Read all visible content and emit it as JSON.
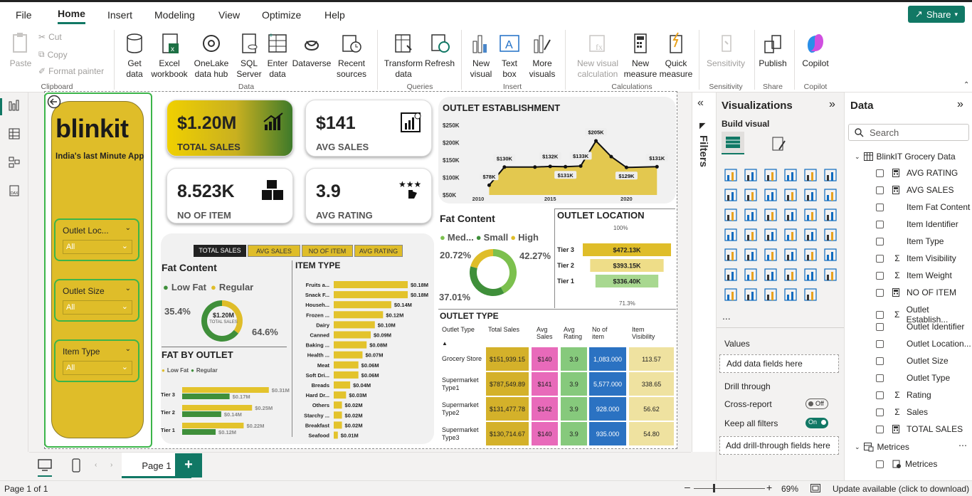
{
  "menu": [
    "File",
    "Home",
    "Insert",
    "Modeling",
    "View",
    "Optimize",
    "Help"
  ],
  "share_label": "Share",
  "ribbon": {
    "clipboard": {
      "paste": "Paste",
      "cut": "Cut",
      "copy": "Copy",
      "format_painter": "Format painter",
      "group": "Clipboard"
    },
    "data": {
      "get_data": "Get",
      "get_data2": "data",
      "excel": "Excel",
      "excel2": "workbook",
      "onelake": "OneLake",
      "onelake2": "data hub",
      "sql": "SQL",
      "sql2": "Server",
      "enter": "Enter",
      "enter2": "data",
      "dataverse": "Dataverse",
      "recent": "Recent",
      "recent2": "sources",
      "group": "Data"
    },
    "queries": {
      "transform": "Transform",
      "transform2": "data",
      "refresh": "Refresh",
      "group": "Queries"
    },
    "insert": {
      "new_visual": "New",
      "new_visual2": "visual",
      "text_box": "Text",
      "text_box2": "box",
      "more_visuals": "More",
      "more_visuals2": "visuals",
      "group": "Insert"
    },
    "calculations": {
      "new_visual_calc": "New visual",
      "new_visual_calc2": "calculation",
      "new_measure": "New",
      "new_measure2": "measure",
      "quick_measure": "Quick",
      "quick_measure2": "measure",
      "group": "Calculations"
    },
    "sensitivity": {
      "label": "Sensitivity",
      "group": "Sensitivity"
    },
    "share": {
      "publish": "Publish",
      "group": "Share"
    },
    "copilot": {
      "label": "Copilot",
      "group": "Copilot"
    }
  },
  "report": {
    "logo": "blinkit",
    "tagline": "India's last Minute App",
    "slicers": [
      {
        "title": "Outlet Loc...",
        "value": "All"
      },
      {
        "title": "Outlet Size",
        "value": "All"
      },
      {
        "title": "Item Type",
        "value": "All"
      }
    ],
    "kpis": [
      {
        "value": "$1.20M",
        "label": "TOTAL SALES"
      },
      {
        "value": "$141",
        "label": "AVG SALES"
      },
      {
        "value": "8.523K",
        "label": "NO OF ITEM"
      },
      {
        "value": "3.9",
        "label": "AVG RATING"
      }
    ],
    "tabs": [
      "TOTAL SALES",
      "AVG SALES",
      "NO OF ITEM",
      "AVG RATING"
    ],
    "fat_content": {
      "title": "Fat Content",
      "legend": [
        "Low Fat",
        "Regular"
      ],
      "pct_left": "35.4%",
      "pct_right": "64.6%",
      "center_value": "$1.20M",
      "center_label": "TOTAL SALES"
    },
    "fat_by_outlet": {
      "title": "FAT BY OUTLET",
      "legend": [
        "Low Fat",
        "Regular"
      ]
    },
    "item_type": {
      "title": "ITEM TYPE"
    },
    "establishment": {
      "title": "OUTLET ESTABLISHMENT"
    },
    "fat_content2": {
      "title": "Fat Content",
      "legend": [
        "Med...",
        "Small",
        "High"
      ],
      "pct_a": "20.72%",
      "pct_b": "42.27%",
      "pct_c": "37.01%"
    },
    "outlet_location": {
      "title": "OUTLET LOCATION",
      "top_pct": "100%",
      "bottom_pct": "71.3%"
    },
    "outlet_type": {
      "title": "OUTLET TYPE",
      "headers": [
        "Outlet Type",
        "Total Sales",
        "Avg Sales",
        "Avg Rating",
        "No of item",
        "Item Visibility"
      ],
      "rows": [
        [
          "Grocery Store",
          "$151,939.15",
          "$140",
          "3.9",
          "1,083.000",
          "113.57"
        ],
        [
          "Supermarket Type1",
          "$787,549.89",
          "$141",
          "3.9",
          "5,577.000",
          "338.65"
        ],
        [
          "Supermarket Type2",
          "$131,477.78",
          "$142",
          "3.9",
          "928.000",
          "56.62"
        ],
        [
          "Supermarket Type3",
          "$130,714.67",
          "$140",
          "3.9",
          "935.000",
          "54.80"
        ]
      ]
    }
  },
  "chart_data": [
    {
      "type": "line",
      "title": "OUTLET ESTABLISHMENT",
      "x": [
        2011,
        2012,
        2014,
        2015,
        2016,
        2017,
        2018,
        2019,
        2020,
        2022
      ],
      "values": [
        78,
        130,
        130,
        132,
        131,
        133,
        205,
        160,
        129,
        131
      ],
      "data_labels": [
        "$78K",
        "$130K",
        "",
        "$132K",
        "$131K",
        "$133K",
        "$205K",
        "",
        "$129K",
        "$131K"
      ],
      "y_ticks": [
        "$250K",
        "$200K",
        "$150K",
        "$100K",
        "$50K"
      ],
      "x_ticks": [
        "2010",
        "2015",
        "2020"
      ],
      "ylim": [
        50,
        250
      ],
      "color": "#e3c84f"
    },
    {
      "type": "bar",
      "title": "ITEM TYPE",
      "categories": [
        "Fruits a...",
        "Snack F...",
        "Househ...",
        "Frozen ...",
        "Dairy",
        "Canned",
        "Baking ...",
        "Health ...",
        "Meat",
        "Soft Dri...",
        "Breads",
        "Hard Dr...",
        "Others",
        "Starchy ...",
        "Breakfast",
        "Seafood"
      ],
      "values": [
        0.18,
        0.18,
        0.14,
        0.12,
        0.1,
        0.09,
        0.08,
        0.07,
        0.06,
        0.06,
        0.04,
        0.03,
        0.02,
        0.02,
        0.02,
        0.01
      ],
      "labels": [
        "$0.18M",
        "$0.18M",
        "$0.14M",
        "$0.12M",
        "$0.10M",
        "$0.09M",
        "$0.08M",
        "$0.07M",
        "$0.06M",
        "$0.06M",
        "$0.04M",
        "$0.03M",
        "$0.02M",
        "$0.02M",
        "$0.02M",
        "$0.01M"
      ],
      "color": "#e3c32c"
    },
    {
      "type": "bar",
      "title": "FAT BY OUTLET",
      "categories": [
        "Tier 3",
        "Tier 2",
        "Tier 1"
      ],
      "series": [
        {
          "name": "Low Fat",
          "values": [
            0.31,
            0.25,
            0.22
          ],
          "labels": [
            "$0.31M",
            "$0.25M",
            "$0.22M"
          ],
          "color": "#e3c32c"
        },
        {
          "name": "Regular",
          "values": [
            0.17,
            0.14,
            0.12
          ],
          "labels": [
            "$0.17M",
            "$0.14M",
            "$0.12M"
          ],
          "color": "#3f8f3a"
        }
      ]
    },
    {
      "type": "bar",
      "title": "OUTLET LOCATION",
      "categories": [
        "Tier 3",
        "Tier 2",
        "Tier 1"
      ],
      "values": [
        472.13,
        393.15,
        336.4
      ],
      "labels": [
        "$472.13K",
        "$393.15K",
        "$336.40K"
      ],
      "colors": [
        "#dfbd29",
        "#eedd88",
        "#a8d890"
      ]
    },
    {
      "type": "pie",
      "title": "Fat Content",
      "categories": [
        "Low Fat",
        "Regular"
      ],
      "values": [
        35.4,
        64.6
      ],
      "colors": [
        "#dfbd29",
        "#3f8f3a"
      ]
    },
    {
      "type": "pie",
      "title": "Fat Content",
      "categories": [
        "Med...",
        "Small",
        "High"
      ],
      "values": [
        42.27,
        37.01,
        20.72
      ],
      "colors": [
        "#7cc04e",
        "#3f8f3a",
        "#dfbd29"
      ]
    }
  ],
  "filters_label": "Filters",
  "viz_pane": {
    "title": "Visualizations",
    "build_visual": "Build visual",
    "values": "Values",
    "add_data": "Add data fields here",
    "drill_through": "Drill through",
    "cross_report": "Cross-report",
    "cross_state": "Off",
    "keep_filters": "Keep all filters",
    "keep_state": "On",
    "add_drill": "Add drill-through fields here",
    "more": "..."
  },
  "data_pane": {
    "title": "Data",
    "search_placeholder": "Search",
    "table1": "BlinkIT Grocery Data",
    "fields": [
      "AVG RATING",
      "AVG SALES",
      "Item Fat Content",
      "Item Identifier",
      "Item Type",
      "Item Visibility",
      "Item Weight",
      "NO OF ITEM",
      "Outlet Establish...",
      "Outlet Identifier",
      "Outlet Location...",
      "Outlet Size",
      "Outlet Type",
      "Rating",
      "Sales",
      "TOTAL SALES"
    ],
    "field_icons": [
      "calc",
      "calc",
      "",
      "",
      "",
      "sigma",
      "sigma",
      "calc",
      "sigma",
      "",
      "",
      "",
      "",
      "sigma",
      "sigma",
      "calc"
    ],
    "table2": "Metrices",
    "table2_fields": [
      "Metrices"
    ]
  },
  "pagebar": {
    "page": "Page 1",
    "add": "+"
  },
  "status": {
    "page": "Page 1 of 1",
    "zoom": "69%",
    "update": "Update available (click to download)"
  }
}
